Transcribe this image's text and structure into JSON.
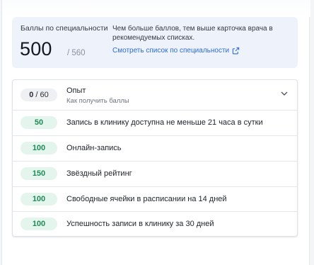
{
  "score": {
    "label": "Баллы по специальности",
    "value": "500",
    "max": "/ 560",
    "hint": "Чем больше баллов, тем выше карточка врача в рекомендуемых списках.",
    "link": "Смотреть список по специальности"
  },
  "experience": {
    "points": "0",
    "max": "/ 60",
    "title": "Опыт",
    "subtitle": "Как получить баллы"
  },
  "criteria": [
    {
      "points": "50",
      "label": "Запись в клинику доступна не меньше 21 часа в сутки"
    },
    {
      "points": "100",
      "label": "Онлайн-запись"
    },
    {
      "points": "150",
      "label": "Звёздный рейтинг"
    },
    {
      "points": "100",
      "label": "Свободные ячейки в расписании на 14 дней"
    },
    {
      "points": "100",
      "label": "Успешность записи в клинику за 30 дней"
    }
  ],
  "colors": {
    "accent": "#2d6ad6",
    "success": "#1f8a57",
    "success_bg": "#e3f5ec",
    "card_bg": "#eef3fb"
  },
  "icons": {
    "link": "external-link-icon",
    "expand": "chevron-down-icon"
  }
}
